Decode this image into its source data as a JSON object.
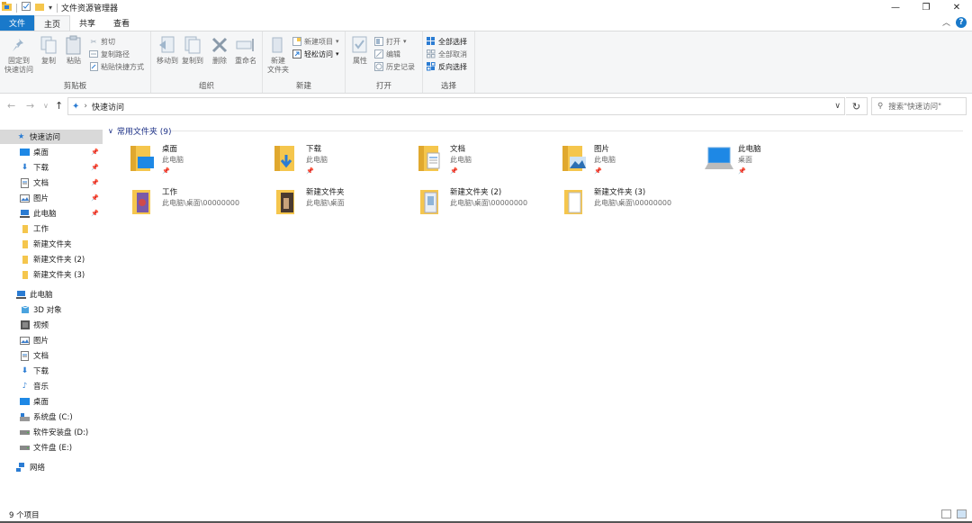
{
  "window": {
    "title": "文件资源管理器",
    "minimize_glyph": "—",
    "maximize_glyph": "❐",
    "close_glyph": "✕"
  },
  "tabs": [
    "文件",
    "主页",
    "共享",
    "查看"
  ],
  "ribbon": {
    "clipboard": {
      "label": "剪贴板",
      "pin_line1": "固定到",
      "pin_line2": "快速访问",
      "copy": "复制",
      "paste": "粘贴",
      "cut": "剪切",
      "copy_path": "复制路径",
      "paste_shortcut": "粘贴快捷方式"
    },
    "organize": {
      "label": "组织",
      "move_to": "移动到",
      "copy_to": "复制到",
      "delete": "删除",
      "rename": "重命名"
    },
    "new": {
      "label": "新建",
      "new_folder_line1": "新建",
      "new_folder_line2": "文件夹",
      "new_item": "新建项目",
      "easy_access": "轻松访问"
    },
    "open": {
      "label": "打开",
      "properties": "属性",
      "open": "打开",
      "edit": "编辑",
      "history": "历史记录"
    },
    "select": {
      "label": "选择",
      "select_all": "全部选择",
      "select_none": "全部取消",
      "invert": "反向选择"
    }
  },
  "address": {
    "path": "快速访问",
    "search_placeholder": "搜索\"快速访问\""
  },
  "nav": {
    "quick_access": "快速访问",
    "qa_items": [
      {
        "label": "桌面",
        "pinned": true
      },
      {
        "label": "下载",
        "pinned": true
      },
      {
        "label": "文档",
        "pinned": true
      },
      {
        "label": "图片",
        "pinned": true
      },
      {
        "label": "此电脑",
        "pinned": true
      },
      {
        "label": "工作",
        "pinned": false
      },
      {
        "label": "新建文件夹",
        "pinned": false
      },
      {
        "label": "新建文件夹 (2)",
        "pinned": false
      },
      {
        "label": "新建文件夹 (3)",
        "pinned": false
      }
    ],
    "this_pc": "此电脑",
    "pc_items": [
      "3D 对象",
      "视频",
      "图片",
      "文档",
      "下载",
      "音乐",
      "桌面",
      "系统盘 (C:)",
      "软件安装盘 (D:)",
      "文件盘 (E:)"
    ],
    "network": "网络"
  },
  "content": {
    "group_title": "常用文件夹 (9)",
    "folders": [
      {
        "name": "桌面",
        "location": "此电脑",
        "pinned": true,
        "icon": "desktop-folder"
      },
      {
        "name": "下载",
        "location": "此电脑",
        "pinned": true,
        "icon": "downloads-folder"
      },
      {
        "name": "文档",
        "location": "此电脑",
        "pinned": true,
        "icon": "documents-folder"
      },
      {
        "name": "图片",
        "location": "此电脑",
        "pinned": true,
        "icon": "pictures-folder"
      },
      {
        "name": "此电脑",
        "location": "桌面",
        "pinned": true,
        "icon": "computer"
      },
      {
        "name": "工作",
        "location": "此电脑\\桌面\\00000000",
        "pinned": false,
        "icon": "folder"
      },
      {
        "name": "新建文件夹",
        "location": "此电脑\\桌面",
        "pinned": false,
        "icon": "folder"
      },
      {
        "name": "新建文件夹 (2)",
        "location": "此电脑\\桌面\\00000000",
        "pinned": false,
        "icon": "folder"
      },
      {
        "name": "新建文件夹 (3)",
        "location": "此电脑\\桌面\\00000000",
        "pinned": false,
        "icon": "folder"
      }
    ]
  },
  "status": {
    "item_count": "9 个项目"
  },
  "colors": {
    "accent": "#1979ca",
    "folder_yellow": "#f5c64d",
    "group_header": "#1e3287"
  }
}
